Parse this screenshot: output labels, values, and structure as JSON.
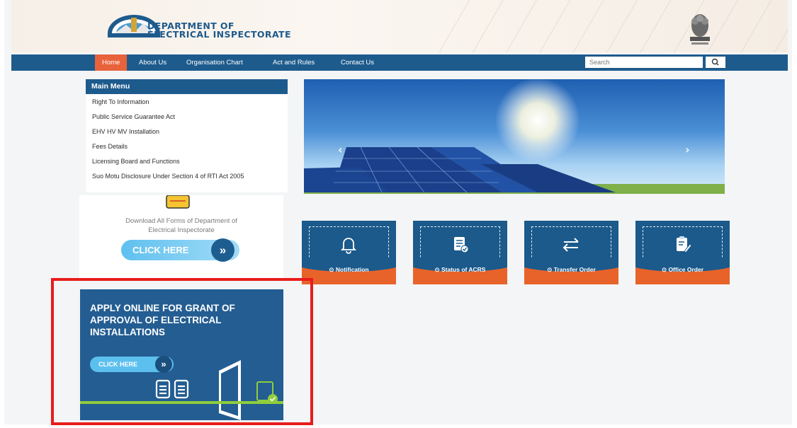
{
  "header": {
    "brand_line1": "DEPARTMENT OF",
    "brand_line2": "ELECTRICAL INSPECTORATE"
  },
  "nav": {
    "items": [
      "Home",
      "About Us",
      "Organisation Chart",
      "Act and Rules",
      "Contact Us"
    ],
    "search_placeholder": "Search"
  },
  "menu": {
    "title": "Main Menu",
    "items": [
      "Right To Information",
      "Public Service Guarantee Act",
      "EHV HV MV Installation",
      "Fees Details",
      "Licensing Board and Functions",
      "Suo Motu Disclosure Under Section 4 of RTI Act 2005"
    ]
  },
  "download": {
    "text_line1": "Download All Forms of Department of",
    "text_line2": "Electrical Inspectorate",
    "button": "CLICK HERE"
  },
  "tiles": [
    {
      "label": "Notification",
      "icon": "bell-icon"
    },
    {
      "label": "Status of ACRS",
      "icon": "checklist-icon"
    },
    {
      "label": "Transfer Order",
      "icon": "transfer-arrows-icon"
    },
    {
      "label": "Office Order",
      "icon": "clipboard-edit-icon"
    }
  ],
  "apply": {
    "title": "APPLY ONLINE FOR GRANT OF APPROVAL OF ELECTRICAL INSTALLATIONS",
    "button": "CLICK HERE"
  },
  "colors": {
    "primary": "#1e5b8d",
    "accent": "#e8632a",
    "highlight": "#e81c1c",
    "light_blue": "#5cc0ee"
  }
}
